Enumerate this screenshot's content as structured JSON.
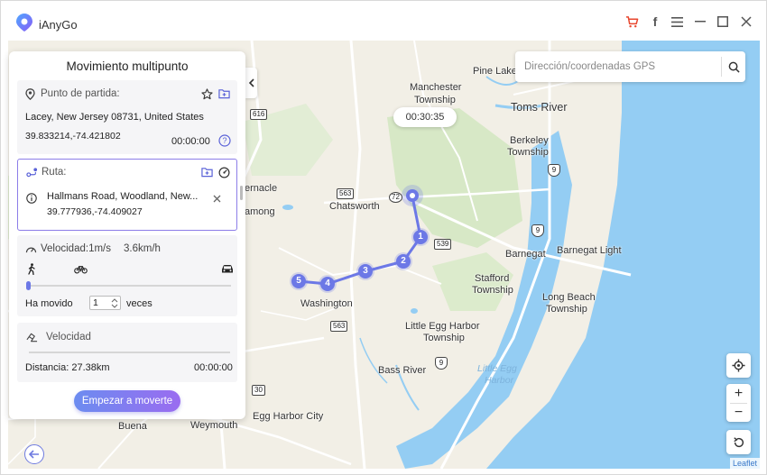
{
  "app": {
    "name": "iAnyGo"
  },
  "titlebar": {
    "icons": [
      "cart-icon",
      "facebook-icon",
      "menu-icon",
      "minimize-icon",
      "maximize-icon",
      "close-icon"
    ],
    "cart_color": "#e8472f"
  },
  "search": {
    "placeholder": "Dirección/coordenadas GPS"
  },
  "timer": {
    "value": "00:30:35"
  },
  "panel": {
    "title": "Movimiento multipunto",
    "start": {
      "label": "Punto de partida:",
      "address": "Lacey, New Jersey 08731, United States",
      "coords": "39.833214,-74.421802",
      "time": "00:00:00"
    },
    "route": {
      "label": "Ruta:",
      "address": "Hallmans Road, Woodland, New...",
      "coords": "39.777936,-74.409027"
    },
    "speed": {
      "label": "Velocidad:1m/s",
      "kmh": "3.6km/h",
      "moved_label": "Ha movido",
      "moved_value": "1",
      "times_label": "veces"
    },
    "progress": {
      "label": "Velocidad",
      "distance": "Distancia: 27.38km",
      "time": "00:00:00"
    },
    "start_button": "Empezar a moverte"
  },
  "map": {
    "labels": {
      "pine_lake": "Pine Lake",
      "manchester": "Manchester",
      "manchester2": "Township",
      "toms_river": "Toms River",
      "berkeley": "Berkeley",
      "berkeley2": "Township",
      "ernacle": "ernacle",
      "among": "among",
      "chatsworth": "Chatsworth",
      "barnegat": "Barnegat",
      "barnegat_light": "Barnegat Light",
      "stafford": "Stafford",
      "stafford2": "Township",
      "long_beach": "Long Beach",
      "long_beach2": "Township",
      "washington": "Washington",
      "little_egg": "Little Egg Harbor",
      "little_egg2": "Township",
      "bass_river": "Bass River",
      "little_egg_water": "Little Egg",
      "little_egg_water2": "Harbor",
      "buena": "Buena",
      "weymouth": "Weymouth",
      "egg_harbor_city": "Egg Harbor City"
    },
    "shields": {
      "r616": "616",
      "r563a": "563",
      "r72": "72",
      "r539": "539",
      "r563b": "563",
      "r9a": "9",
      "r9b": "9",
      "r9c": "9",
      "r30": "30"
    },
    "waypoints": [
      "1",
      "2",
      "3",
      "4",
      "5"
    ],
    "attribution": "Leaflet",
    "accent": "#6c78e6"
  }
}
